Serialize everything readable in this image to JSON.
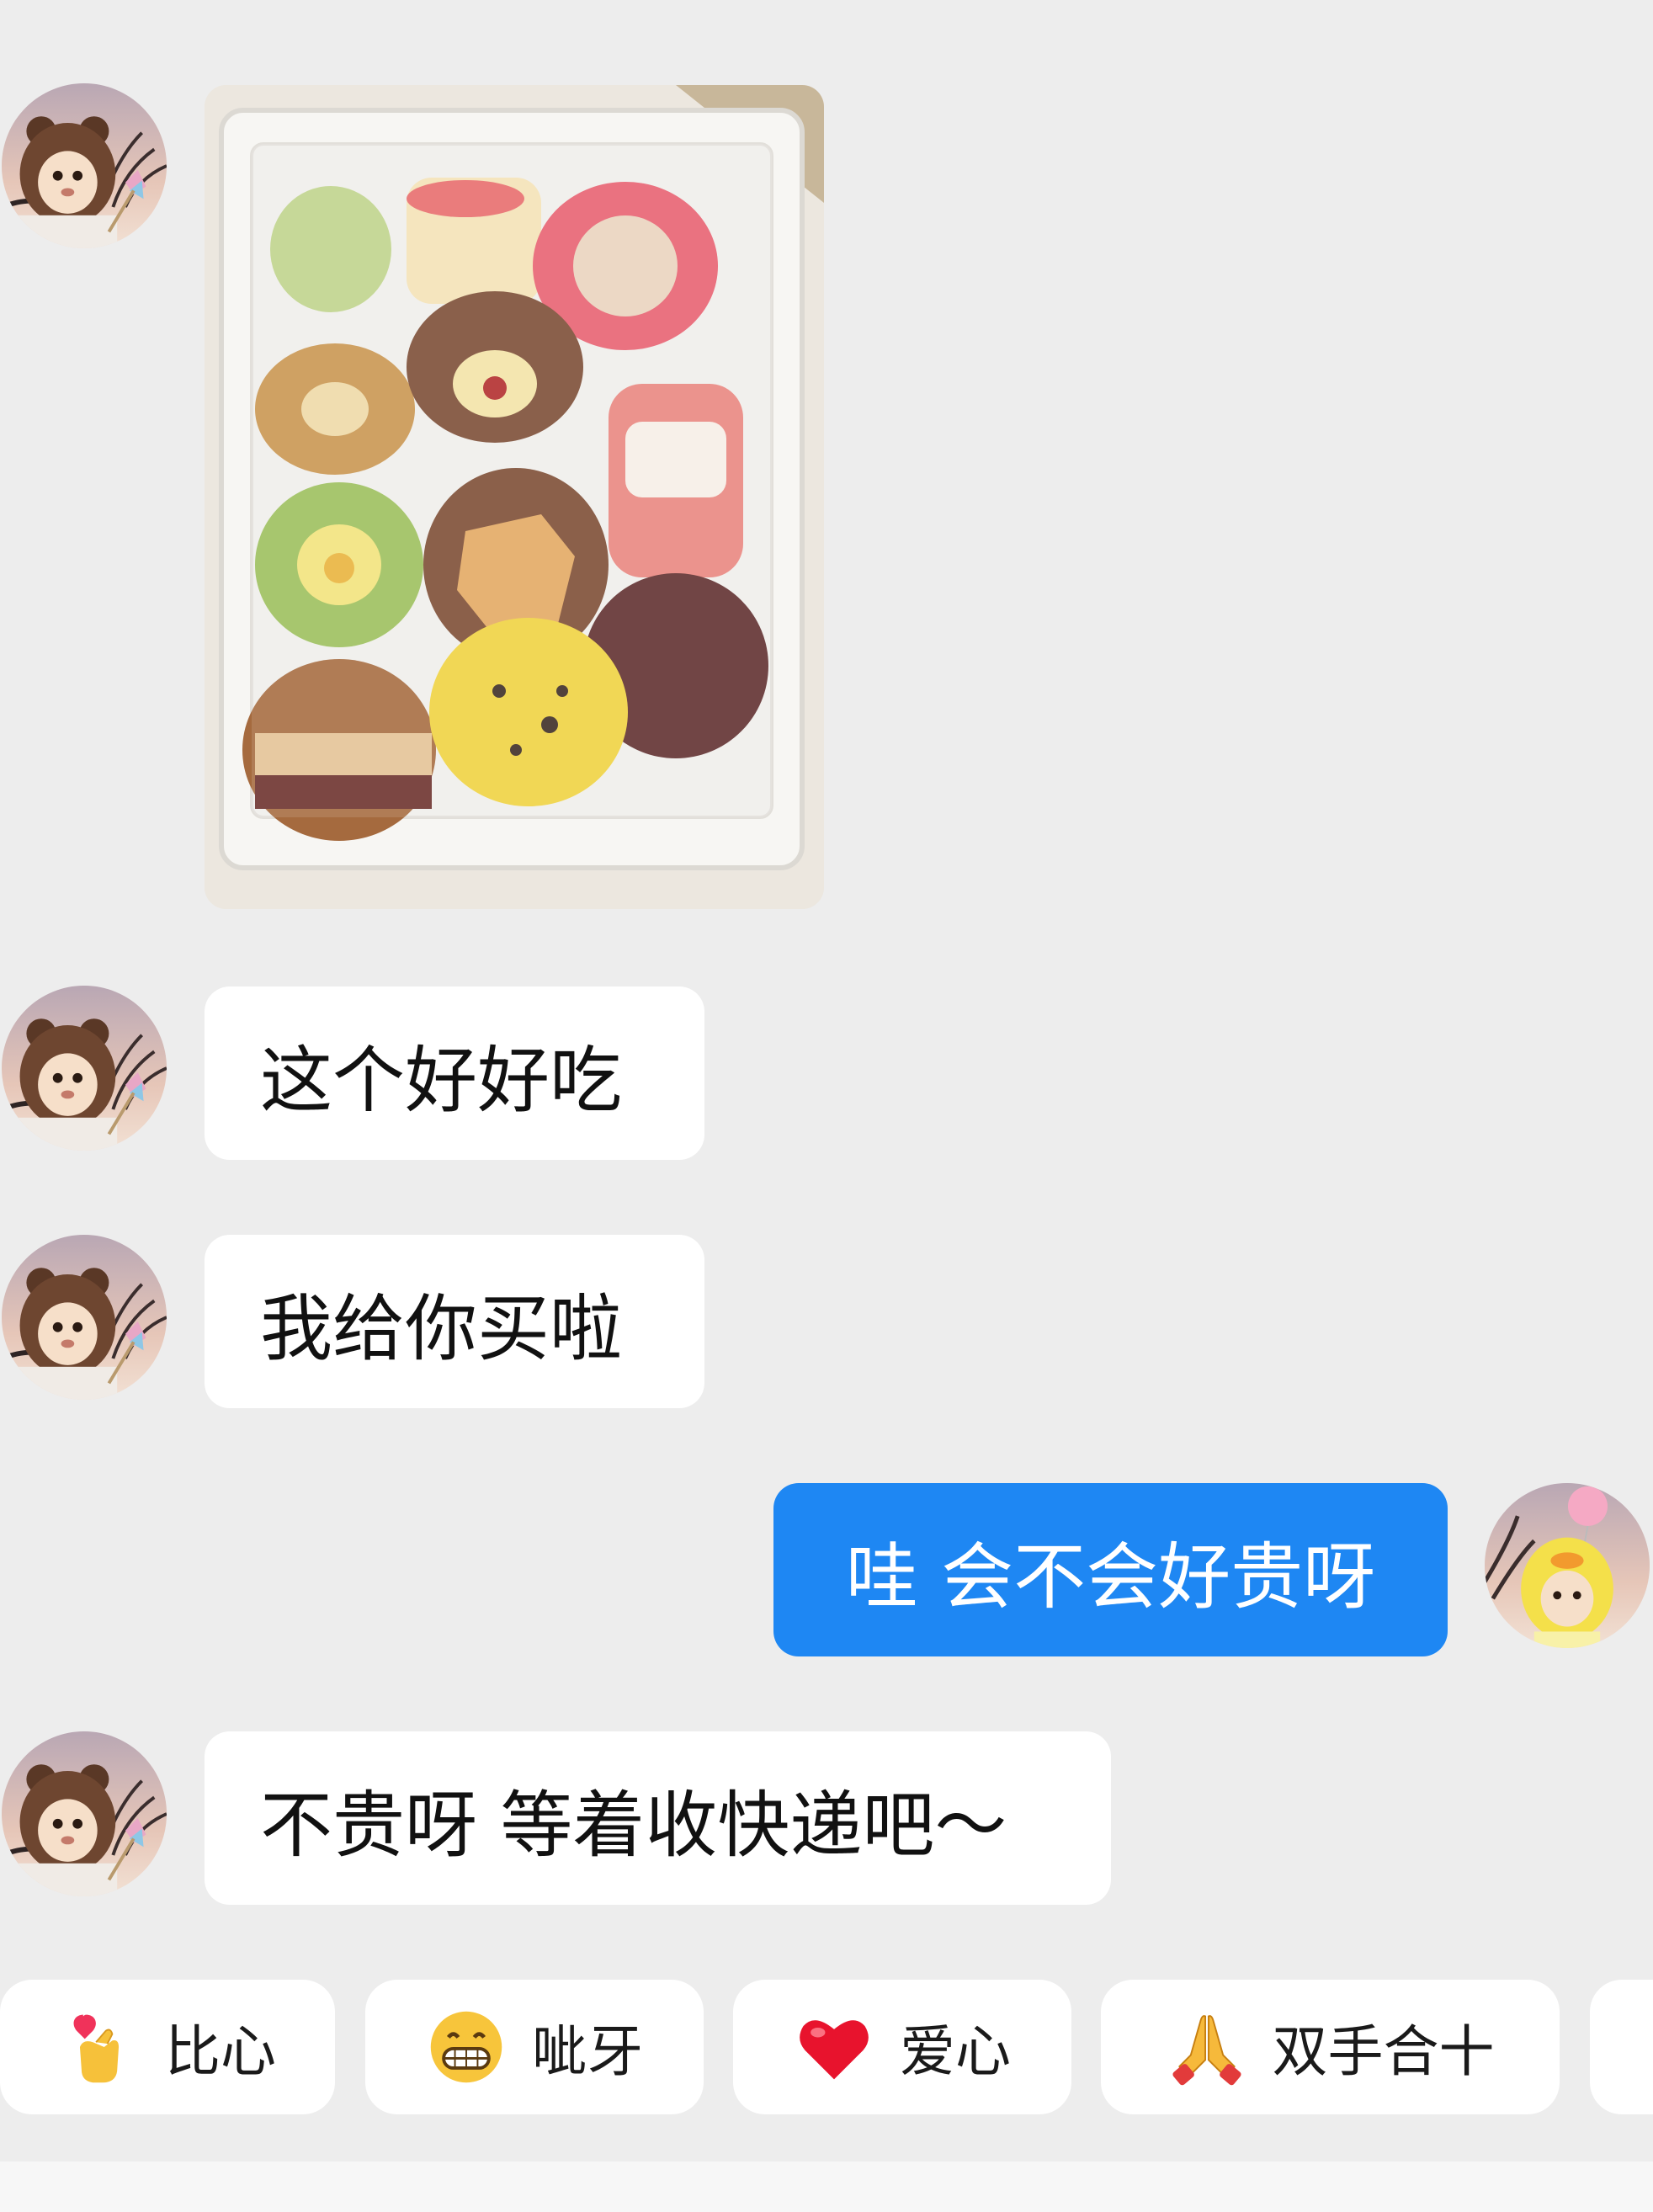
{
  "conversation": {
    "messages": [
      {
        "sender": "friend",
        "type": "image",
        "avatar_icon": "bear-avatar",
        "image_alt": "packed-pastries-photo"
      },
      {
        "sender": "friend",
        "type": "text",
        "text": "这个好好吃"
      },
      {
        "sender": "friend",
        "type": "text",
        "text": "我给你买啦"
      },
      {
        "sender": "me",
        "type": "text",
        "text": "哇 会不会好贵呀"
      },
      {
        "sender": "friend",
        "type": "text",
        "text": "不贵呀 等着收快递吧～"
      }
    ]
  },
  "quick_reactions": [
    {
      "label": "比心",
      "icon": "finger-heart-icon"
    },
    {
      "label": "呲牙",
      "icon": "grin-icon"
    },
    {
      "label": "爱心",
      "icon": "heart-icon"
    },
    {
      "label": "双手合十",
      "icon": "folded-hands-icon"
    }
  ],
  "colors": {
    "background": "#ededed",
    "my_bubble": "#1e87f3",
    "their_bubble": "#ffffff"
  }
}
